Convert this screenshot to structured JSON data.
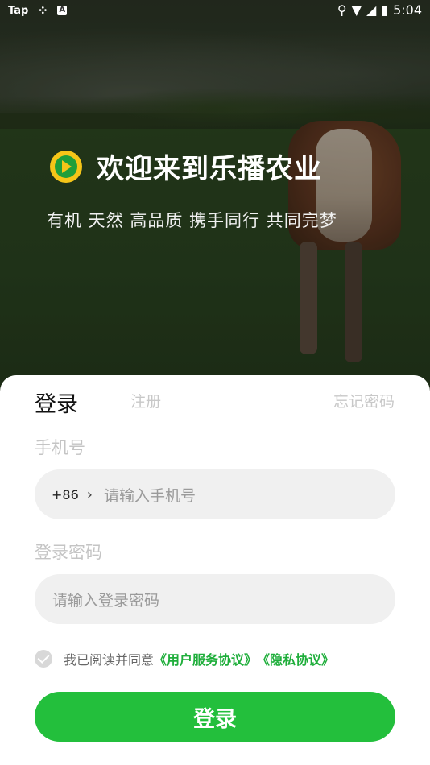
{
  "status_bar": {
    "app_label": "Tap",
    "time": "5:04"
  },
  "hero": {
    "title": "欢迎来到乐播农业",
    "slogan": "有机 天然 高品质 携手同行 共同完梦"
  },
  "tabs": {
    "login": "登录",
    "register": "注册",
    "forgot_password": "忘记密码"
  },
  "form": {
    "phone_label": "手机号",
    "country_code": "+86",
    "phone_placeholder": "请输入手机号",
    "password_label": "登录密码",
    "password_placeholder": "请输入登录密码"
  },
  "agreement": {
    "prefix": "我已阅读并同意",
    "user_agreement": "《用户服务协议》",
    "privacy": "《隐私协议》",
    "checked": false
  },
  "submit_label": "登录",
  "colors": {
    "accent": "#23bf3c",
    "link": "#1fae3b",
    "logo_yellow": "#f5c518"
  },
  "icons": [
    "location-icon",
    "wifi-icon",
    "signal-icon",
    "battery-icon",
    "chevron-right-icon",
    "check-icon",
    "play-logo-icon"
  ]
}
